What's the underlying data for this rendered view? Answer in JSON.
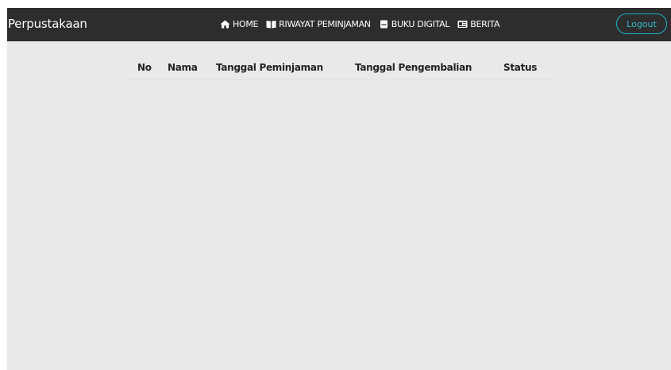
{
  "navbar": {
    "brand": "Perpustakaan",
    "items": [
      {
        "label": "HOME",
        "icon": "home-icon"
      },
      {
        "label": "RIWAYAT PEMINJAMAN",
        "icon": "book-open-icon"
      },
      {
        "label": "BUKU DIGITAL",
        "icon": "tablet-icon"
      },
      {
        "label": "BERITA",
        "icon": "newspaper-icon"
      }
    ],
    "logout_label": "Logout"
  },
  "table": {
    "headers": {
      "no": "No",
      "nama": "Nama",
      "tanggal_peminjaman": "Tanggal Peminjaman",
      "tanggal_pengembalian": "Tanggal Pengembalian",
      "status": "Status"
    },
    "rows": []
  },
  "colors": {
    "navbar_bg": "#2d2d2d",
    "page_bg": "#e9e9e9",
    "logout_accent": "#1fb0c2"
  }
}
